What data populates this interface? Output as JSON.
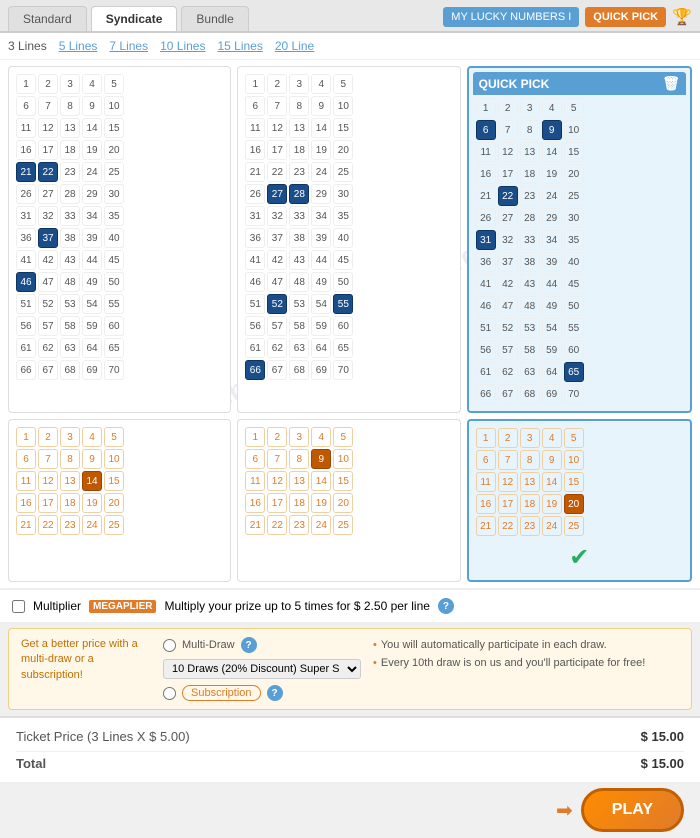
{
  "tabs": [
    {
      "label": "Standard",
      "active": false
    },
    {
      "label": "Syndicate",
      "active": true
    },
    {
      "label": "Bundle",
      "active": false
    }
  ],
  "topBar": {
    "luckyBtn": "MY LUCKY NUMBERS I",
    "quickPickBtn": "QUICK PICK"
  },
  "linesNav": {
    "prefix": "3 Lines",
    "links": [
      "5 Lines",
      "7 Lines",
      "10 Lines",
      "15 Lines",
      "20 Line"
    ]
  },
  "quickPickHeader": "QUICK PICK",
  "multiplier": {
    "label": "Multiplier",
    "badge": "MEGAPLIER",
    "description": "Multiply your prize up to 5 times for $ 2.50 per line"
  },
  "subscriptionBar": {
    "leftText": "Get a better price with a multi-draw or a subscription!",
    "multiDrawLabel": "Multi-Draw",
    "subscriptionLabel": "Subscription",
    "selectOption": "10 Draws (20% Discount) Super S",
    "bullets": [
      "You will automatically participate in each draw.",
      "Every 10th draw is on us and you'll participate for free!"
    ]
  },
  "ticket": {
    "priceLabel": "Ticket Price (3 Lines X $ 5.00)",
    "priceAmount": "$ 15.00",
    "totalLabel": "Total",
    "totalAmount": "$ 15.00",
    "playLabel": "PLAY"
  },
  "grids": {
    "panel1": {
      "numbers": [
        1,
        2,
        3,
        4,
        5,
        6,
        7,
        8,
        9,
        10,
        11,
        12,
        13,
        14,
        15,
        16,
        17,
        18,
        19,
        20,
        21,
        22,
        23,
        24,
        25,
        26,
        27,
        28,
        29,
        30,
        31,
        32,
        33,
        34,
        35,
        36,
        37,
        38,
        39,
        40,
        41,
        42,
        43,
        44,
        45,
        46,
        47,
        48,
        49,
        50,
        51,
        52,
        53,
        54,
        55,
        56,
        57,
        58,
        59,
        60,
        61,
        62,
        63,
        64,
        65,
        66,
        67,
        68,
        69,
        70
      ],
      "selected": [
        21,
        22,
        37,
        46
      ]
    },
    "panel2": {
      "numbers": [
        1,
        2,
        3,
        4,
        5,
        6,
        7,
        8,
        9,
        10,
        11,
        12,
        13,
        14,
        15,
        16,
        17,
        18,
        19,
        20,
        21,
        22,
        23,
        24,
        25,
        26,
        27,
        28,
        29,
        30,
        31,
        32,
        33,
        34,
        35,
        36,
        37,
        38,
        39,
        40,
        41,
        42,
        43,
        44,
        45,
        46,
        47,
        48,
        49,
        50,
        51,
        52,
        53,
        54,
        55,
        56,
        57,
        58,
        59,
        60,
        61,
        62,
        63,
        64,
        65,
        66,
        67,
        68,
        69,
        70
      ],
      "selected": [
        27,
        28,
        52,
        55,
        66
      ]
    },
    "panel3": {
      "numbers": [
        1,
        2,
        3,
        4,
        5,
        6,
        7,
        8,
        9,
        10,
        11,
        12,
        13,
        14,
        15,
        16,
        17,
        18,
        19,
        20,
        21,
        22,
        23,
        24,
        25,
        26,
        27,
        28,
        29,
        30,
        31,
        32,
        33,
        34,
        35,
        36,
        37,
        38,
        39,
        40,
        41,
        42,
        43,
        44,
        45,
        46,
        47,
        48,
        49,
        50,
        51,
        52,
        53,
        54,
        55,
        56,
        57,
        58,
        59,
        60,
        61,
        62,
        63,
        64,
        65,
        66,
        67,
        68,
        69,
        70
      ],
      "selected": [
        6,
        9,
        22,
        31,
        65
      ]
    },
    "orange1": {
      "numbers": [
        1,
        2,
        3,
        4,
        5,
        6,
        7,
        8,
        9,
        10,
        11,
        12,
        13,
        14,
        15,
        16,
        17,
        18,
        19,
        20,
        21,
        22,
        23,
        24,
        25
      ],
      "selected": [
        14
      ]
    },
    "orange2": {
      "numbers": [
        1,
        2,
        3,
        4,
        5,
        6,
        7,
        8,
        9,
        10,
        11,
        12,
        13,
        14,
        15,
        16,
        17,
        18,
        19,
        20,
        21,
        22,
        23,
        24,
        25
      ],
      "selected": [
        9
      ]
    },
    "orange3": {
      "numbers": [
        1,
        2,
        3,
        4,
        5,
        6,
        7,
        8,
        9,
        10,
        11,
        12,
        13,
        14,
        15,
        16,
        17,
        18,
        19,
        20,
        21,
        22,
        23,
        24,
        25
      ],
      "selected": [
        20
      ]
    }
  }
}
